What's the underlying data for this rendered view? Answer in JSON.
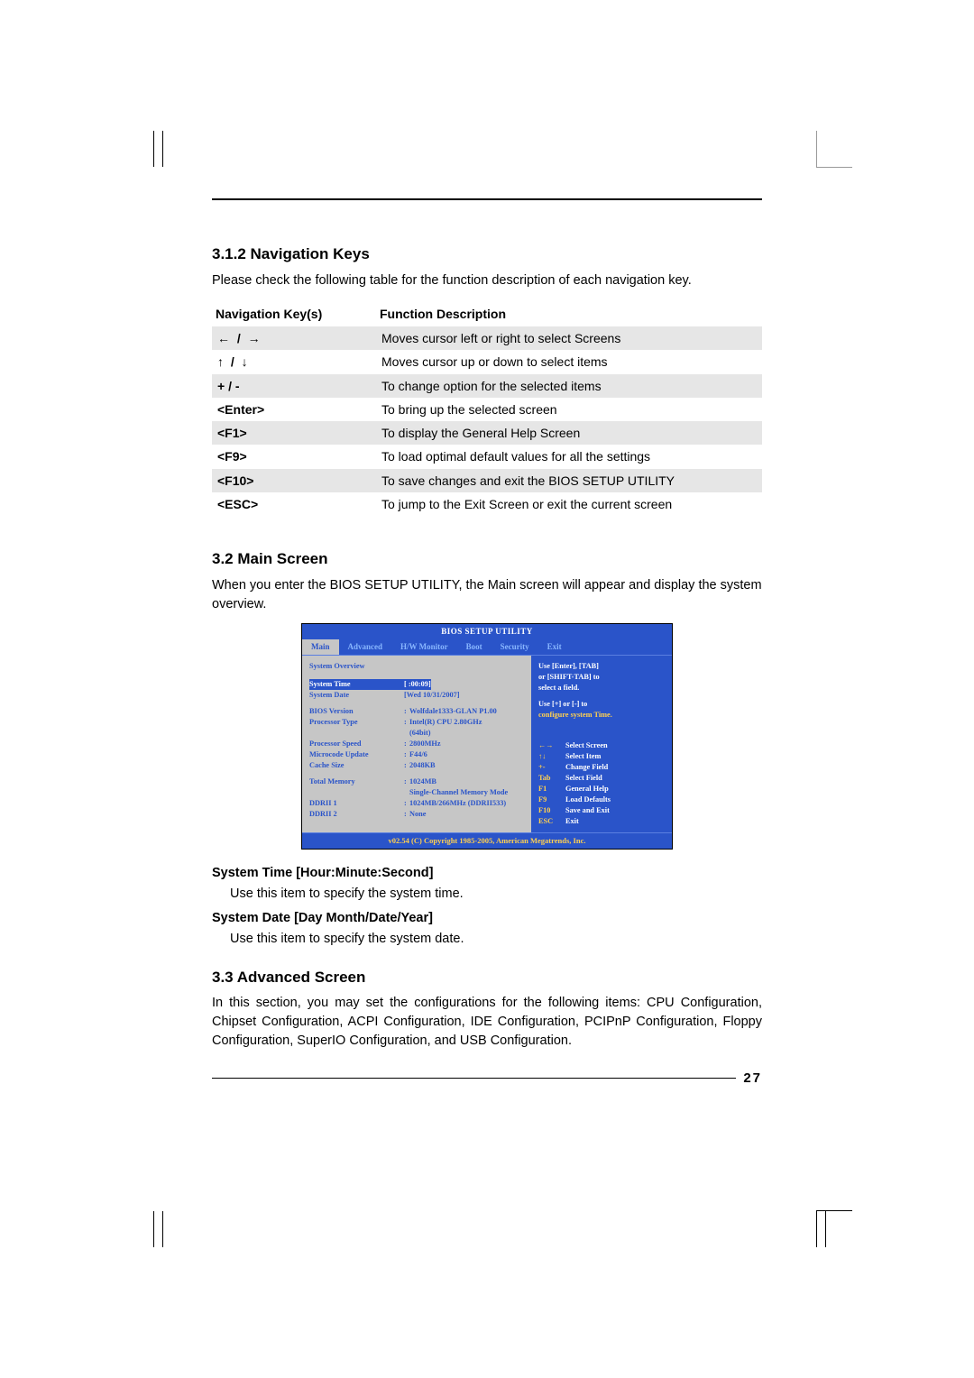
{
  "section312": {
    "heading": "3.1.2 Navigation Keys",
    "intro": "Please check the following table for the function description of each navigation key.",
    "th1": "Navigation Key(s)",
    "th2": "Function Description",
    "rows": [
      {
        "key": "← / →",
        "desc": "Moves cursor left or right to select Screens",
        "arrow": true
      },
      {
        "key": "↑ / ↓",
        "desc": "Moves cursor up or down to select items",
        "arrow": true
      },
      {
        "key": "+  /  -",
        "desc": "To change option for the selected items"
      },
      {
        "key": "<Enter>",
        "desc": "To bring up the selected screen"
      },
      {
        "key": "<F1>",
        "desc": "To display the General Help Screen"
      },
      {
        "key": "<F9>",
        "desc": "To load optimal default values for all the settings"
      },
      {
        "key": "<F10>",
        "desc": "To save changes and exit the BIOS SETUP UTILITY"
      },
      {
        "key": "<ESC>",
        "desc": "To jump to the Exit Screen or exit the current screen"
      }
    ]
  },
  "section32": {
    "heading": "3.2 Main Screen",
    "intro": "When you enter the BIOS SETUP UTILITY, the Main screen will appear and display the system overview."
  },
  "bios": {
    "title": "BIOS SETUP UTILITY",
    "tabs": [
      "Main",
      "Advanced",
      "H/W Monitor",
      "Boot",
      "Security",
      "Exit"
    ],
    "overview_label": "System Overview",
    "time_label": "System Time",
    "time_val": "[  :00:09]",
    "date_label": "System Date",
    "date_val": "[Wed 10/31/2007]",
    "info": [
      {
        "l": "BIOS Version",
        "v": "Wolfdale1333-GLAN P1.00"
      },
      {
        "l": "Processor Type",
        "v": "Intel(R)   CPU 2.80GHz"
      },
      {
        "l": "",
        "v": "(64bit)"
      },
      {
        "l": "Processor Speed",
        "v": "2800MHz"
      },
      {
        "l": "Microcode Update",
        "v": "F44/6"
      },
      {
        "l": "Cache Size",
        "v": "2048KB"
      }
    ],
    "mem": [
      {
        "l": "Total Memory",
        "v": "1024MB"
      },
      {
        "l": "",
        "v": "Single-Channel Memory Mode"
      },
      {
        "l": "     DDRII 1",
        "v": "1024MB/266MHz (DDRII533)"
      },
      {
        "l": "     DDRII 2",
        "v": "None"
      }
    ],
    "help1": "Use [Enter], [TAB]",
    "help2": "or [SHIFT-TAB] to",
    "help3": "select a field.",
    "help4": "Use [+] or [-] to",
    "help5": "configure system Time.",
    "keys": [
      {
        "k": "←→",
        "d": "Select Screen"
      },
      {
        "k": "↑↓",
        "d": "Select Item"
      },
      {
        "k": "+-",
        "d": "Change Field"
      },
      {
        "k": "Tab",
        "d": "Select Field"
      },
      {
        "k": "F1",
        "d": "General Help"
      },
      {
        "k": "F9",
        "d": "Load Defaults"
      },
      {
        "k": "F10",
        "d": "Save and Exit"
      },
      {
        "k": "ESC",
        "d": "Exit"
      }
    ],
    "footer": "v02.54 (C) Copyright 1985-2005, American Megatrends, Inc."
  },
  "main_items": {
    "time_head": "System Time [Hour:Minute:Second]",
    "time_desc": "Use this item to specify the system time.",
    "date_head": "System Date [Day Month/Date/Year]",
    "date_desc": "Use this item to specify the system date."
  },
  "section33": {
    "heading": "3.3 Advanced Screen",
    "intro": "In this section, you may set the configurations for the following items: CPU Configuration, Chipset Configuration, ACPI Configuration, IDE Configuration, PCIPnP Configuration, Floppy Configuration, SuperIO Configuration, and USB Configuration."
  },
  "page_number": "27"
}
